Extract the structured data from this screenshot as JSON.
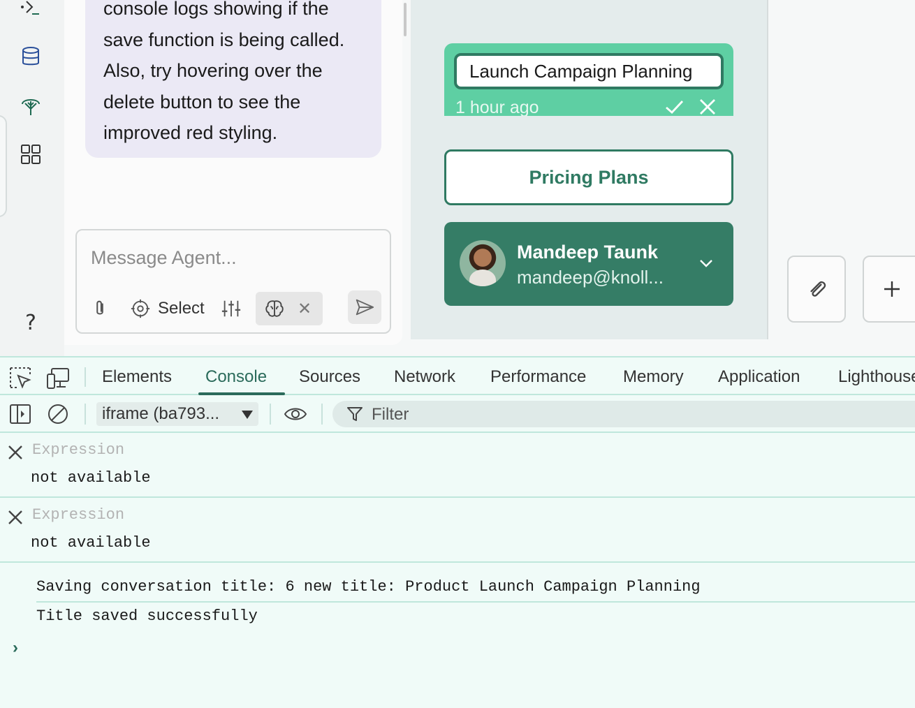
{
  "colors": {
    "accent": "#2f7a62",
    "edit_card": "#5ecfa3",
    "user_card": "#357d66",
    "devtools_bg": "#f0fbf8"
  },
  "rail": {
    "icons": [
      "terminal-icon",
      "database-icon",
      "tree-icon",
      "grid-icon",
      "help-icon"
    ]
  },
  "chat": {
    "bubble_lines": [
      "console logs showing if the",
      "save function is being called.",
      "Also, try hovering over the",
      "delete button to see the",
      "improved red styling."
    ],
    "composer_placeholder": "Message Agent...",
    "select_label": "Select",
    "chip_close": "✕"
  },
  "conversations": {
    "editing_value": "Launch Campaign Planning",
    "editing_time": "1 hour ago",
    "items": [
      "Pricing Plans"
    ]
  },
  "user": {
    "name": "Mandeep Taunk",
    "email": "mandeep@knoll..."
  },
  "devtools": {
    "tabs": [
      "Elements",
      "Console",
      "Sources",
      "Network",
      "Performance",
      "Memory",
      "Application",
      "Lighthouse"
    ],
    "active_tab": "Console",
    "context_select": "iframe (ba793...",
    "filter_placeholder": "Filter",
    "watch_expressions": [
      {
        "placeholder": "Expression",
        "value": "not available"
      },
      {
        "placeholder": "Expression",
        "value": "not available"
      }
    ],
    "logs": [
      "Saving conversation title: 6 new title: Product Launch Campaign Planning",
      "Title saved successfully"
    ],
    "prompt": "›"
  }
}
